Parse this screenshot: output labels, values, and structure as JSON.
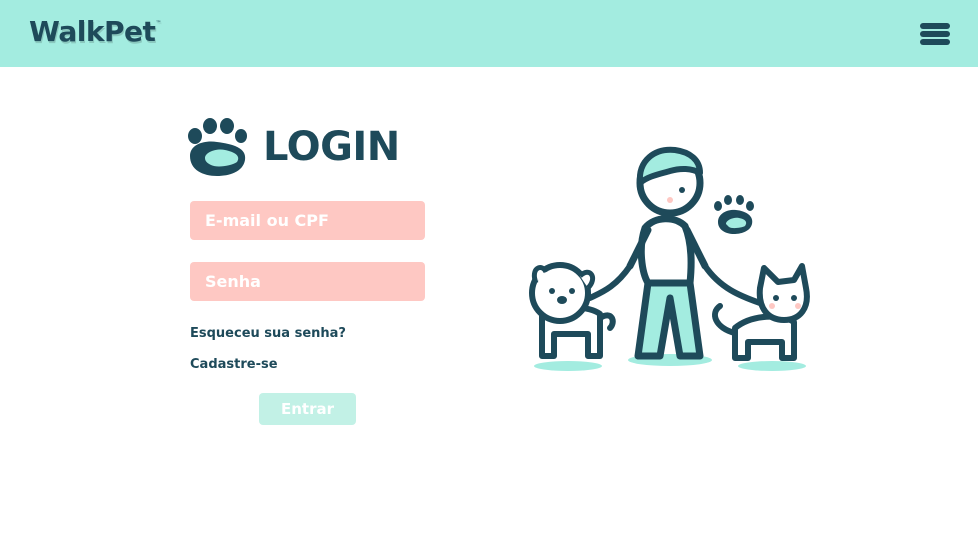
{
  "header": {
    "brand": "WalkPet",
    "brand_mark": "™",
    "menu_icon": "hamburger-menu-icon",
    "background_color": "#a3ece0",
    "brand_color": "#1e4a5a"
  },
  "login": {
    "title": "LOGIN",
    "title_icon": "paw-icon",
    "email_placeholder": "E-mail ou CPF",
    "password_placeholder": "Senha",
    "forgot_password": "Esqueceu sua senha?",
    "signup": "Cadastre-se",
    "submit": "Entrar",
    "field_color": "#fec8c3",
    "button_color": "#c2f1e6"
  },
  "illustration": {
    "icon": "person-walking-dog-and-cat-illustration"
  }
}
